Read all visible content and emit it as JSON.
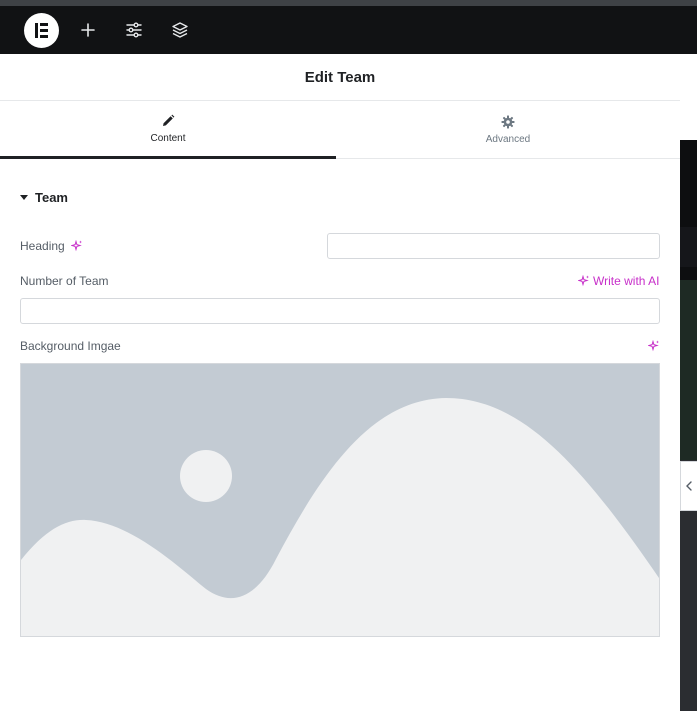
{
  "panel": {
    "title": "Edit Team"
  },
  "tabs": [
    {
      "label": "Content",
      "icon": "pencil-icon",
      "active": true
    },
    {
      "label": "Advanced",
      "icon": "gear-icon",
      "active": false
    }
  ],
  "section": {
    "title": "Team"
  },
  "fields": {
    "heading": {
      "label": "Heading",
      "value": ""
    },
    "number_of_team": {
      "label": "Number of Team",
      "value": "",
      "ai_label": "Write with AI"
    },
    "background_image": {
      "label": "Background Imgae"
    }
  },
  "colors": {
    "accent_ai": "#c72fc9",
    "topbar": "#111214",
    "placeholder_bg": "#c3cbd3",
    "placeholder_fg": "#f0f1f2"
  }
}
